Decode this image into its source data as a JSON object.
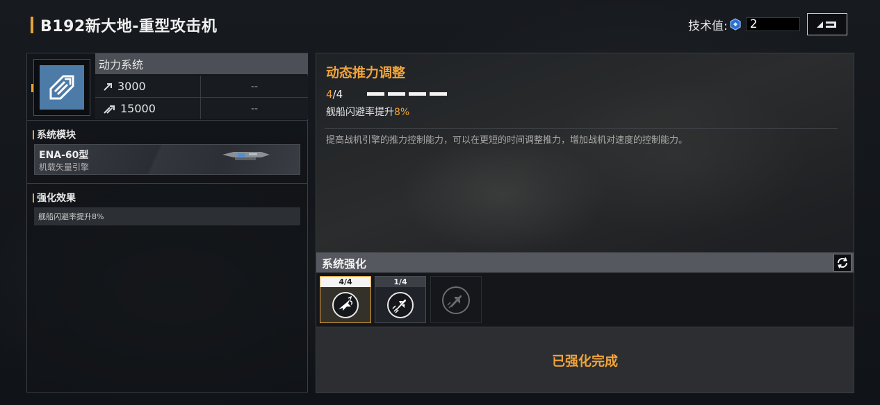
{
  "header": {
    "title": "B192新大地-重型攻击机",
    "tech_label": "技术值:",
    "tech_value": "2",
    "back_icon": "return-arrow-icon"
  },
  "system": {
    "name": "动力系统",
    "icon": "thrust-module-icon",
    "stats": [
      {
        "icon": "speed-icon",
        "value": "3000",
        "extra": "--"
      },
      {
        "icon": "boost-speed-icon",
        "value": "15000",
        "extra": "--"
      }
    ]
  },
  "module_section": {
    "title": "系统模块",
    "module_name": "ENA-60型",
    "module_desc": "机载矢量引擎"
  },
  "effect_section": {
    "title": "强化效果",
    "effect_text": "舰船闪避率提升8%"
  },
  "detail": {
    "title": "动态推力调整",
    "level_current": "4",
    "level_sep": "/4",
    "level_pips": 4,
    "effect_prefix": "舰船闪避率提升",
    "effect_value": "8%",
    "description": "提高战机引擎的推力控制能力，可以在更短的时间调整推力，增加战机对速度的控制能力。"
  },
  "enhance": {
    "title": "系统强化",
    "slots": [
      {
        "level": "4/4",
        "state": "active",
        "icon": "dodge-jet-icon"
      },
      {
        "level": "1/4",
        "state": "normal",
        "icon": "speed-jet-icon"
      },
      {
        "level": "",
        "state": "locked",
        "icon": "locked-jet-icon"
      }
    ],
    "status": "已强化完成"
  },
  "colors": {
    "accent": "#f0a43a",
    "system_icon_bg": "#4d7ba8"
  }
}
